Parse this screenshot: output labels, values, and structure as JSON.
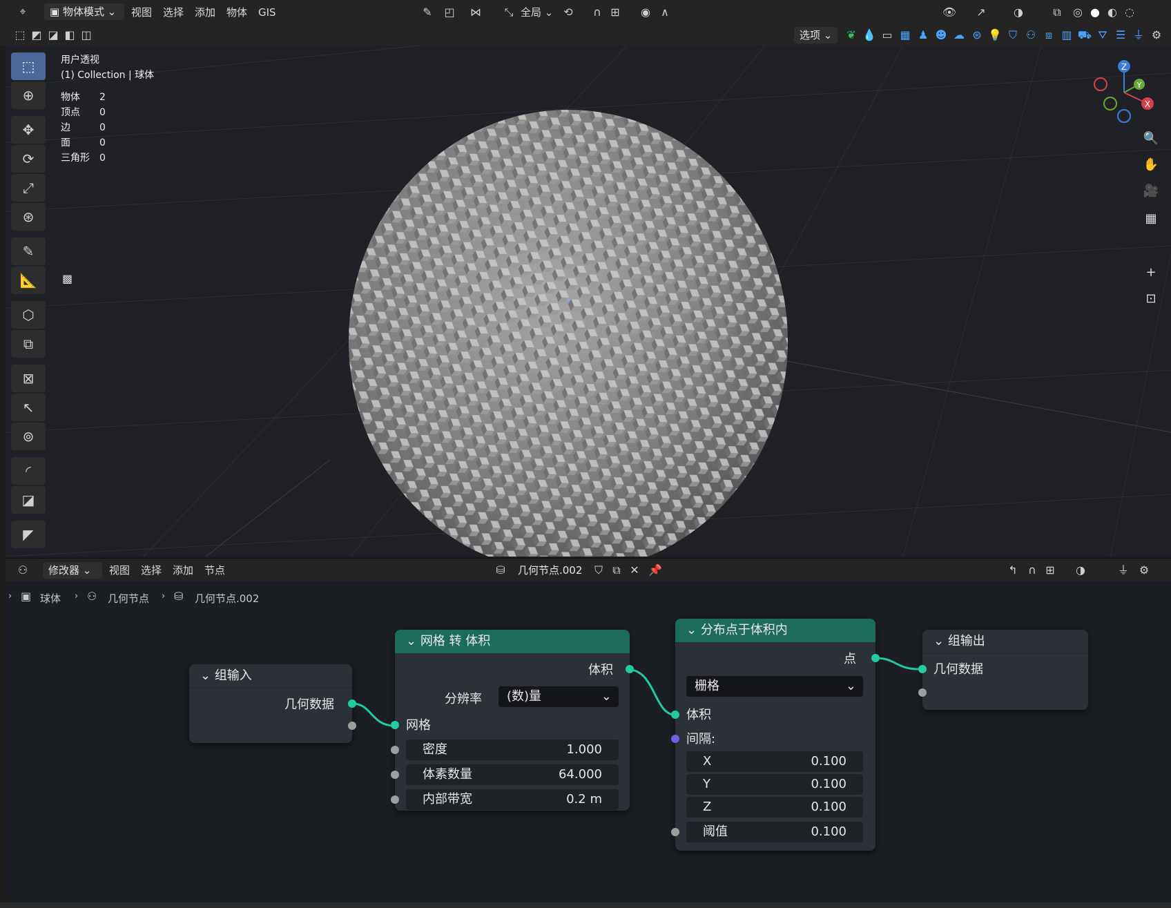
{
  "topbar": {
    "mode": "物体模式",
    "menus": [
      "视图",
      "选择",
      "添加",
      "物体",
      "GIS"
    ],
    "transform_orientation": "全局",
    "options": "选项"
  },
  "viewport": {
    "view_name": "用户透视",
    "collection_label": "(1) Collection | 球体",
    "stats": [
      {
        "label": "物体",
        "value": "2"
      },
      {
        "label": "顶点",
        "value": "0"
      },
      {
        "label": "边",
        "value": "0"
      },
      {
        "label": "面",
        "value": "0"
      },
      {
        "label": "三角形",
        "value": "0"
      }
    ],
    "gizmo": {
      "z": "Z",
      "y": "Y",
      "x": "X"
    }
  },
  "node_editor": {
    "header": {
      "type": "修改器",
      "menus": [
        "视图",
        "选择",
        "添加",
        "节点"
      ],
      "tree_name": "几何节点.002"
    },
    "breadcrumb": [
      "球体",
      "几何节点",
      "几何节点.002"
    ],
    "nodes": {
      "group_input": {
        "title": "组输入",
        "out_geometry": "几何数据"
      },
      "mesh_to_volume": {
        "title": "网格 转 体积",
        "out_volume": "体积",
        "resolution_label": "分辨率",
        "resolution_value": "(数)量",
        "in_mesh": "网格",
        "density_label": "密度",
        "density_value": "1.000",
        "voxel_label": "体素数量",
        "voxel_value": "64.000",
        "band_label": "内部带宽",
        "band_value": "0.2 m"
      },
      "distribute": {
        "title": "分布点于体积内",
        "out_points": "点",
        "mode": "栅格",
        "in_volume": "体积",
        "spacing_label": "间隔:",
        "x_label": "X",
        "x_value": "0.100",
        "y_label": "Y",
        "y_value": "0.100",
        "z_label": "Z",
        "z_value": "0.100",
        "threshold_label": "阈值",
        "threshold_value": "0.100"
      },
      "group_output": {
        "title": "组输出",
        "in_geometry": "几何数据"
      }
    }
  },
  "colors": {
    "node_header_green": "#1d6b5b",
    "socket_geometry": "#23c9a0",
    "socket_vector": "#6b63dd",
    "socket_float": "#9e9e9e",
    "active_tool": "#4a6a9a"
  }
}
